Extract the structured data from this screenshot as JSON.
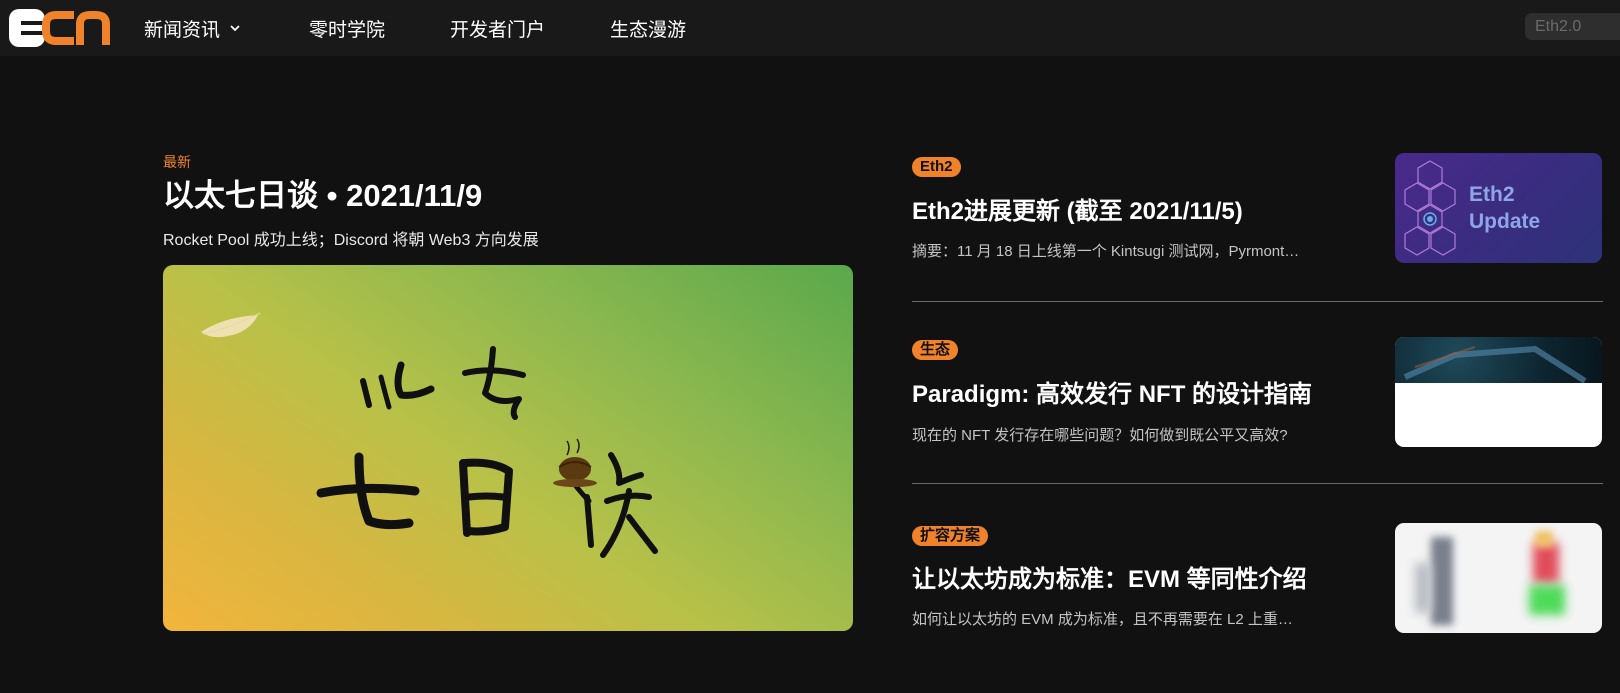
{
  "header": {
    "nav": [
      {
        "label": "新闻资讯",
        "has_dropdown": true
      },
      {
        "label": "零时学院",
        "has_dropdown": false
      },
      {
        "label": "开发者门户",
        "has_dropdown": false
      },
      {
        "label": "生态漫游",
        "has_dropdown": false
      }
    ],
    "search_placeholder": "Eth2.0"
  },
  "featured": {
    "tag": "最新",
    "title": "以太七日谈 • 2021/11/9",
    "subtitle": "Rocket Pool 成功上线；Discord 将朝 Web3 方向发展"
  },
  "articles": [
    {
      "tag": "Eth2",
      "title": "Eth2进展更新 (截至 2021/11/5)",
      "summary": "摘要：11 月 18 日上线第一个 Kintsugi 测试网，Pyrmont…",
      "thumb_text_1": "Eth2",
      "thumb_text_2": "Update"
    },
    {
      "tag": "生态",
      "title": "Paradigm: 高效发行 NFT 的设计指南",
      "summary": "现在的 NFT 发行存在哪些问题？如何做到既公平又高效?"
    },
    {
      "tag": "扩容方案",
      "title": "让以太坊成为标准：EVM 等同性介绍",
      "summary": "如何让以太坊的 EVM 成为标准，且不再需要在 L2 上重…"
    }
  ],
  "colors": {
    "accent": "#f0832a",
    "background": "#111111",
    "header_bg": "#191919"
  }
}
